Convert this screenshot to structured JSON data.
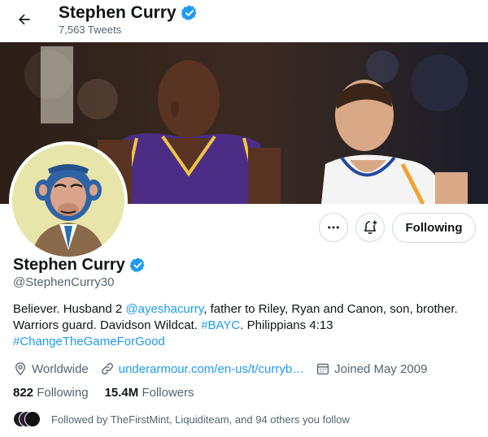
{
  "header": {
    "title": "Stephen Curry",
    "tweet_count": "7,563 Tweets"
  },
  "profile": {
    "name": "Stephen Curry",
    "handle": "@StephenCurry30",
    "bio": {
      "t1": "Believer. Husband 2 ",
      "mention": "@ayeshacurry",
      "t2": ", father to Riley, Ryan and Canon, son, brother. Warriors guard. Davidson Wildcat. ",
      "hashtag1": "#BAYC",
      "t3": ". Philippians 4:13",
      "hashtag2": "#ChangeTheGameForGood"
    },
    "location": "Worldwide",
    "website": "underarmour.com/en-us/t/curryb…",
    "joined": "Joined May 2009",
    "following_count": "822",
    "following_label": "Following",
    "followers_count": "15.4M",
    "followers_label": "Followers",
    "followed_by": "Followed by TheFirstMint, Liquiditeam, and 94 others you follow"
  },
  "actions": {
    "follow_label": "Following"
  },
  "icons": {
    "back": "arrow-left-icon",
    "verified": "verified-badge-icon",
    "more": "more-dots-icon",
    "notify": "bell-plus-icon",
    "location": "location-pin-icon",
    "link": "link-icon",
    "calendar": "calendar-icon"
  },
  "colors": {
    "accent": "#1d9bf0",
    "text": "#0f1419",
    "secondary": "#536471",
    "border": "#cfd9de",
    "avatar_bg": "#e8e5ab"
  }
}
